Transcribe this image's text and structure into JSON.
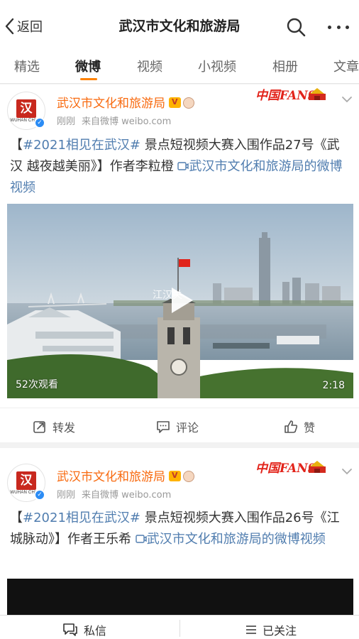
{
  "navbar": {
    "back_label": "返回",
    "title": "武汉市文化和旅游局"
  },
  "tabs": [
    {
      "label": "精选"
    },
    {
      "label": "微博"
    },
    {
      "label": "视频"
    },
    {
      "label": "小视频"
    },
    {
      "label": "相册"
    },
    {
      "label": "文章"
    }
  ],
  "posts": [
    {
      "author": "武汉市文化和旅游局",
      "time": "刚刚",
      "source": "来自微博 weibo.com",
      "hashtag": "#2021相见在武汉#",
      "text": "景点短视频大赛入围作品27号《武汉 越夜越美丽》】作者李粒橙",
      "bracket_open": "【",
      "video_link": "武汉市文化和旅游局的微博视频",
      "views": "52次观看",
      "duration": "2:18",
      "watermark": "江汉关",
      "fans_banner": "中国FANS"
    },
    {
      "author": "武汉市文化和旅游局",
      "time": "刚刚",
      "source": "来自微博 weibo.com",
      "hashtag": "#2021相见在武汉#",
      "text": "景点短视频大赛入围作品26号《江城脉动》】作者王乐希",
      "bracket_open": "【",
      "video_link": "武汉市文化和旅游局的微博视频",
      "fans_banner": "中国FANS"
    }
  ],
  "actions": {
    "repost": "转发",
    "comment": "评论",
    "like": "赞"
  },
  "avatar": {
    "seal": "汉",
    "sub": "WUHAN CHINA"
  },
  "bottombar": {
    "message": "私信",
    "followed": "已关注"
  },
  "colors": {
    "accent": "#ff8200",
    "username": "#f86a0f",
    "link": "#507daf",
    "verified": "#2b8cf5"
  }
}
